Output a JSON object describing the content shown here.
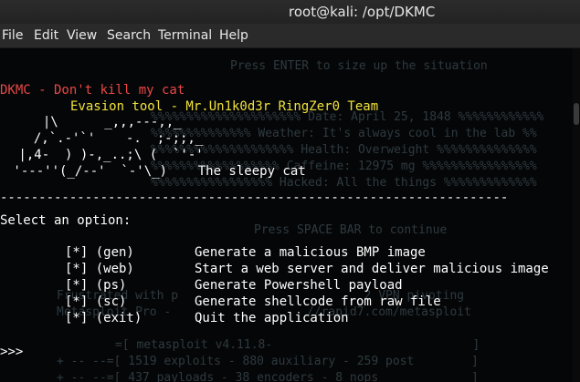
{
  "window": {
    "title": "root@kali: /opt/DKMC"
  },
  "menu": [
    "File",
    "Edit",
    "View",
    "Search",
    "Terminal",
    "Help"
  ],
  "background_text": [
    "Press ENTER to size up the situation",
    "%%%%%%%%%%%%%%%%%%%%% Date: April 25, 1848 %%%%%%%%%%%%",
    "%%%%%%%%%%%%%% Weather: It's always cool in the lab %%",
    "%%%%%%%%%%%%%%%%%%%% Health: Overweight %%%%%%%%%%%%%%",
    "%%%%%%%%%%%%%%%%%% Caffeine: 12975 mg %%%%%%%%%%%%%%%%",
    "%%%%%%%%%%%%%%%%% Hacked: All the things %%%%%%%%%%%%%",
    "Press SPACE BAR to continue",
    "Frustrated with p                          2 VPN pivoting",
    "Metasploit Pro -                   //rapid7.com/metasploit",
    "=[ metasploit v4.11.8-                            ]",
    "+ -- --=[ 1519 exploits - 880 auxiliary - 259 post        ]",
    "+ -- --=[ 437 payloads - 38 encoders - 8 nops             ]"
  ],
  "terminal": {
    "banner": "DKMC - Don't kill my cat",
    "subtitle": "Evasion tool - Mr.Un1k0d3r RingZer0 Team",
    "ascii_cat": [
      "  |\\      _,,,---,,_",
      "  /,`.-'`'    -.  ;-;;,_",
      " |,4-  ) )-,_..;\\ (  `'-'",
      " '---''(_/--'  `-'\\_)    The sleepy cat"
    ],
    "separator": "------------------------------------------------------------------",
    "prompt_heading": "Select an option:",
    "options": [
      {
        "tag": "[*] (gen)",
        "desc": "Generate a malicious BMP image"
      },
      {
        "tag": "[*] (web)",
        "desc": "Start a web server and deliver malicious image"
      },
      {
        "tag": "[*] (ps)",
        "desc": "Generate Powershell payload"
      },
      {
        "tag": "[*] (sc)",
        "desc": "Generate shellcode from raw file"
      },
      {
        "tag": "[*] (exit)",
        "desc": "Quit the application"
      }
    ],
    "prompt": ">>>"
  }
}
